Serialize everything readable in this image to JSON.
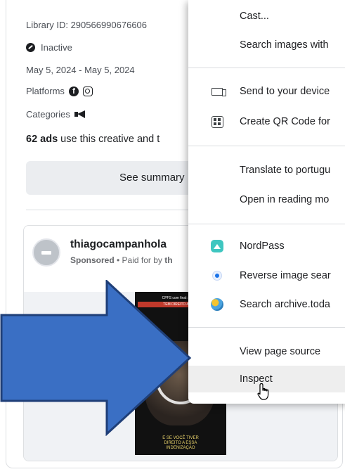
{
  "ad_card": {
    "library_id": "Library ID: 290566990676606",
    "status": "Inactive",
    "date_range": "May 5, 2024 - May 5, 2024",
    "platforms_label": "Platforms",
    "categories_label": "Categories",
    "ads_count": "62 ads",
    "ads_text": " use this creative and t",
    "summary_button": "See summary",
    "advertiser_name": "thiagocampanhola",
    "sponsored_label": "Sponsored",
    "paid_for_prefix": " • Paid for by ",
    "paid_for_name": "th",
    "media": {
      "top_text": "CPFS com final: 5,9,1,3",
      "banner_text": "TEM DIREITO A INDE",
      "caption_line1": "E SE VOCÊ TIVER",
      "caption_line2": "DIREITO A ESSA",
      "caption_line3": "INDENIZAÇÃO"
    }
  },
  "context_menu": {
    "items": [
      {
        "label": "Cast...",
        "icon": ""
      },
      {
        "label": "Search images with",
        "icon": ""
      },
      {
        "label": "Send to your device",
        "icon": "screen-icon"
      },
      {
        "label": "Create QR Code for",
        "icon": "qr-code-icon"
      },
      {
        "label": "Translate to portugu",
        "icon": ""
      },
      {
        "label": "Open in reading mo",
        "icon": ""
      },
      {
        "label": "NordPass",
        "icon": "nordpass-icon"
      },
      {
        "label": "Reverse image sear",
        "icon": "reverse-image-icon"
      },
      {
        "label": "Search archive.toda",
        "icon": "archive-globe-icon"
      },
      {
        "label": "View page source",
        "icon": ""
      },
      {
        "label": "Inspect",
        "icon": ""
      }
    ],
    "hovered_item": "Inspect"
  },
  "colors": {
    "arrow_fill": "#3a6fc4",
    "arrow_stroke": "#1f3f78",
    "menu_hover": "#eeeeee",
    "nordpass": "#3ec6c0"
  }
}
